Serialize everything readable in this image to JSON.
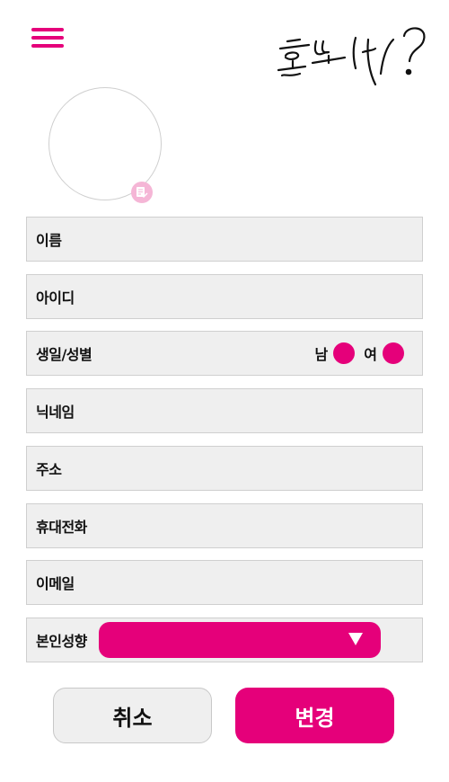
{
  "header": {
    "menu_icon": "hamburger-menu-icon",
    "logo_text": "혼또니?",
    "accent_color": "#e5007a"
  },
  "profile": {
    "edit_icon": "edit-photo-icon"
  },
  "fields": {
    "name": "이름",
    "user_id": "아이디",
    "birth_gender": "생일/성별",
    "nickname": "닉네임",
    "address": "주소",
    "phone": "휴대전화",
    "email": "이메일",
    "personality": "본인성향"
  },
  "gender": {
    "male": "남",
    "female": "여"
  },
  "personality_select": {
    "selected": ""
  },
  "buttons": {
    "cancel": "취소",
    "change": "변경"
  }
}
